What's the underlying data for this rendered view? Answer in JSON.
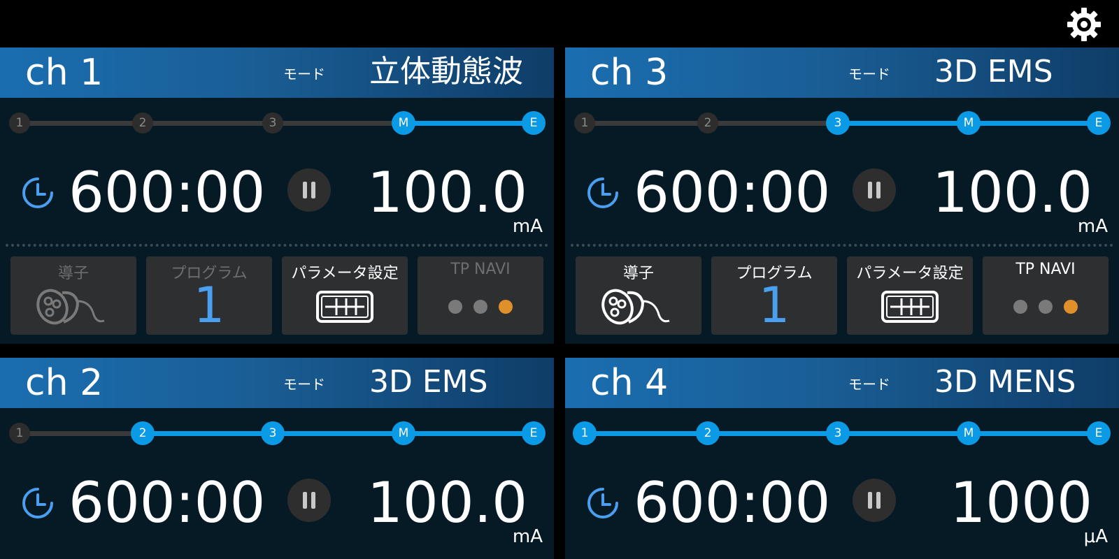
{
  "channels": [
    {
      "name": "ch 1",
      "mode_label": "モード",
      "mode": "立体動態波",
      "time": "600:00",
      "current": "100.0",
      "unit": "mA",
      "steps": [
        "1",
        "2",
        "3",
        "M",
        "E"
      ],
      "active_from": 3,
      "buttons": {
        "electrode": "導子",
        "program": "プログラム",
        "program_value": "1",
        "params": "パラメータ設定",
        "navi": "TP NAVI"
      },
      "buttons_dim": true
    },
    {
      "name": "ch 3",
      "mode_label": "モード",
      "mode": "3D EMS",
      "time": "600:00",
      "current": "100.0",
      "unit": "mA",
      "steps": [
        "1",
        "2",
        "3",
        "M",
        "E"
      ],
      "active_from": 2,
      "buttons": {
        "electrode": "導子",
        "program": "プログラム",
        "program_value": "1",
        "params": "パラメータ設定",
        "navi": "TP NAVI"
      },
      "buttons_dim": false
    },
    {
      "name": "ch 2",
      "mode_label": "モード",
      "mode": "3D EMS",
      "time": "600:00",
      "current": "100.0",
      "unit": "mA",
      "steps": [
        "1",
        "2",
        "3",
        "M",
        "E"
      ],
      "active_from": 1
    },
    {
      "name": "ch 4",
      "mode_label": "モード",
      "mode": "3D MENS",
      "time": "600:00",
      "current": "1000",
      "unit": "μA",
      "steps": [
        "1",
        "2",
        "3",
        "M",
        "E"
      ],
      "active_from": 0
    }
  ],
  "colors": {
    "accent": "#0b9be6",
    "program": "#4a9ff0",
    "navi_active": "#e0902a",
    "navi_idle": "#7a7a7a"
  },
  "icons": {
    "settings": "gear-icon",
    "timer": "clock-icon",
    "pause": "pause-icon",
    "electrode": "probe-icon",
    "params": "parameter-grid-icon"
  }
}
